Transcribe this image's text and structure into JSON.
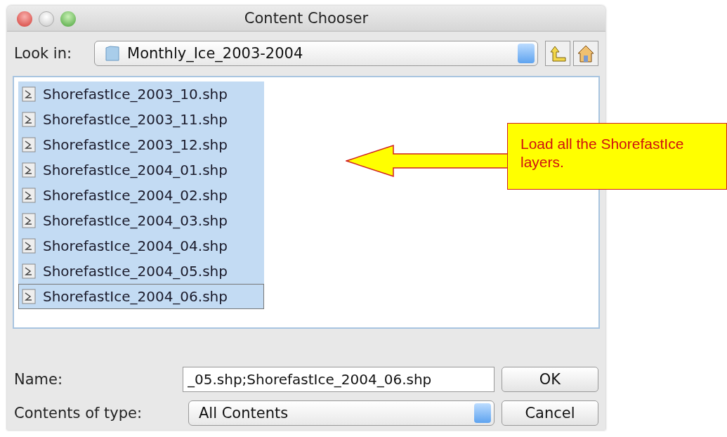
{
  "window": {
    "title": "Content Chooser"
  },
  "look_in": {
    "label": "Look in:",
    "value": "Monthly_Ice_2003-2004"
  },
  "files": [
    {
      "name": "ShorefastIce_2003_10.shp",
      "selected": true,
      "focused": false
    },
    {
      "name": "ShorefastIce_2003_11.shp",
      "selected": true,
      "focused": false
    },
    {
      "name": "ShorefastIce_2003_12.shp",
      "selected": true,
      "focused": false
    },
    {
      "name": "ShorefastIce_2004_01.shp",
      "selected": true,
      "focused": false
    },
    {
      "name": "ShorefastIce_2004_02.shp",
      "selected": true,
      "focused": false
    },
    {
      "name": "ShorefastIce_2004_03.shp",
      "selected": true,
      "focused": false
    },
    {
      "name": "ShorefastIce_2004_04.shp",
      "selected": true,
      "focused": false
    },
    {
      "name": "ShorefastIce_2004_05.shp",
      "selected": true,
      "focused": false
    },
    {
      "name": "ShorefastIce_2004_06.shp",
      "selected": true,
      "focused": true
    }
  ],
  "name_field": {
    "label": "Name:",
    "value": "_05.shp;ShorefastIce_2004_06.shp"
  },
  "type_field": {
    "label": "Contents of type:",
    "value": "All Contents"
  },
  "buttons": [
    "OK",
    "Cancel"
  ],
  "callout": {
    "text": "Load all the ShorefastIce layers."
  }
}
